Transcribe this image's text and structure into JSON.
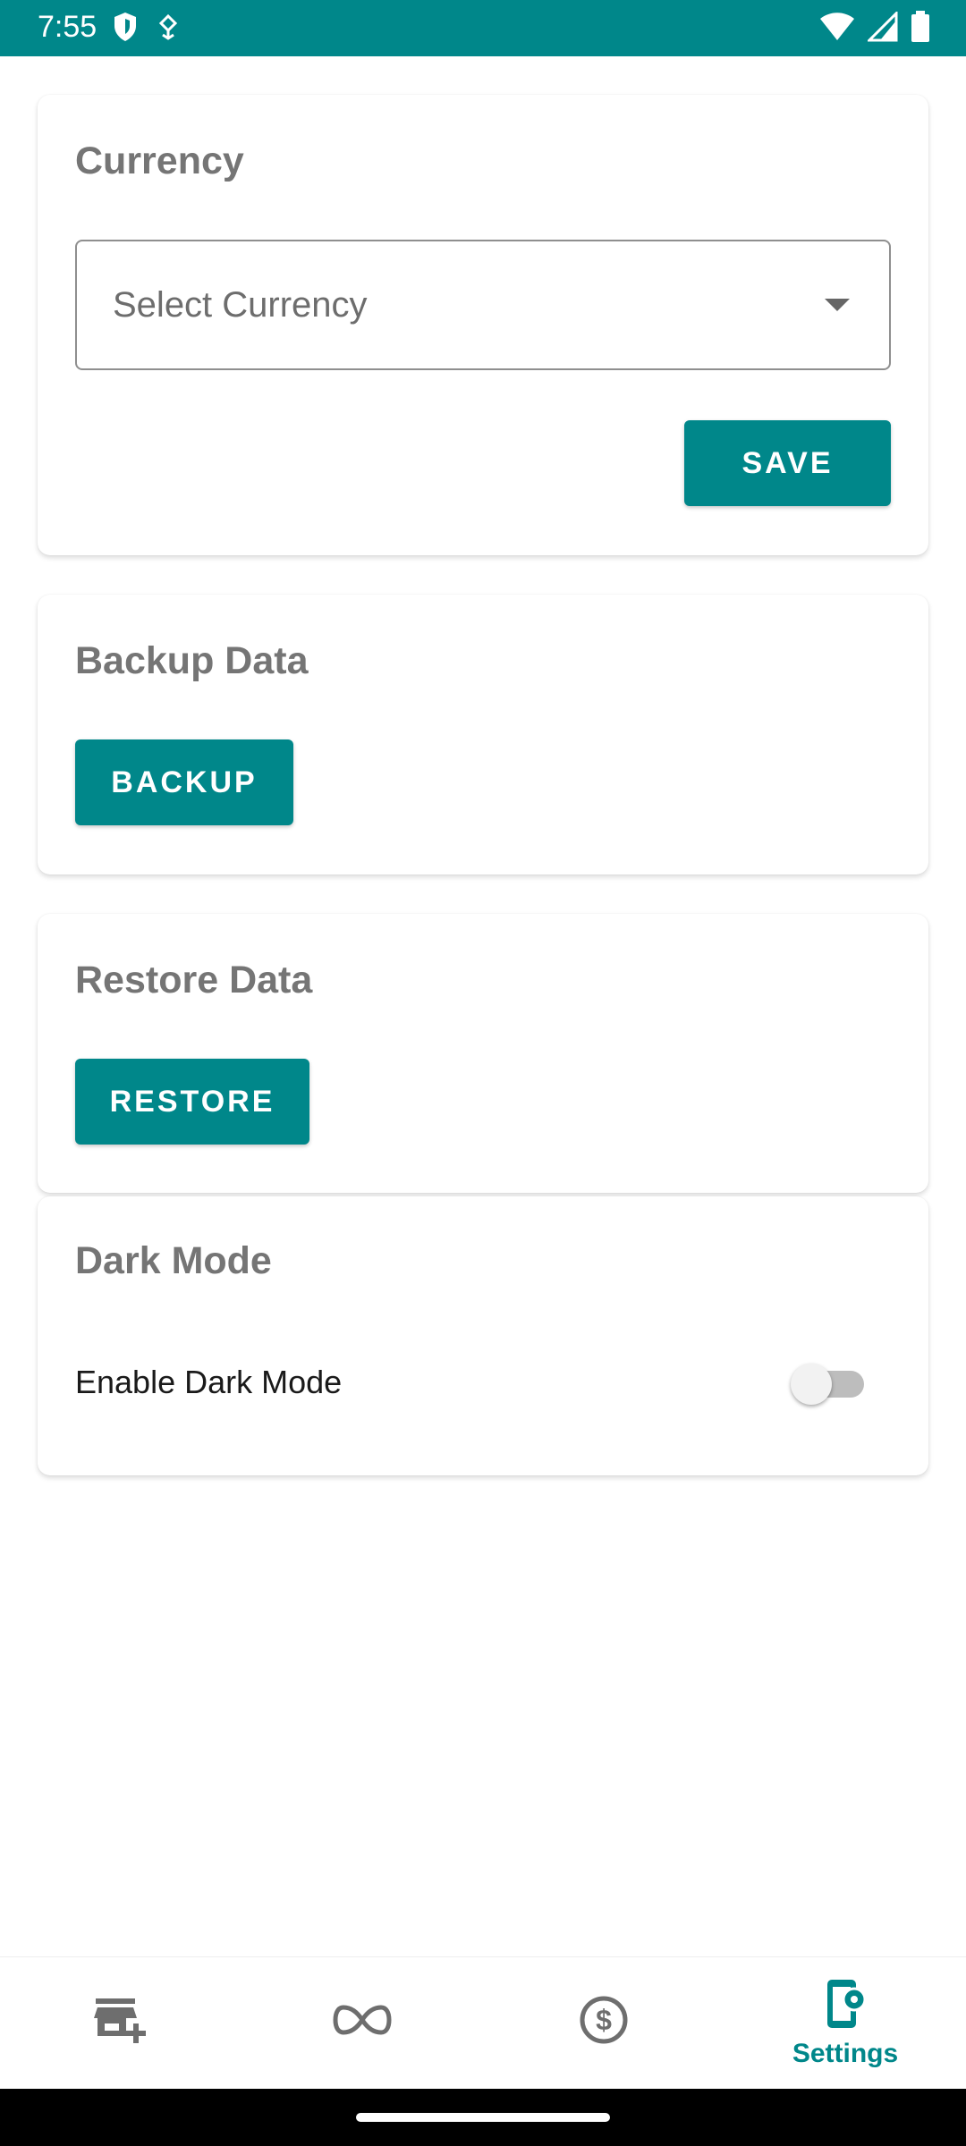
{
  "status_bar": {
    "time": "7:55",
    "background": "#00878a"
  },
  "currency_card": {
    "title": "Currency",
    "select_placeholder": "Select Currency",
    "save_label": "SAVE"
  },
  "backup_card": {
    "title": "Backup Data",
    "button_label": "BACKUP"
  },
  "restore_card": {
    "title": "Restore Data",
    "button_label": "RESTORE"
  },
  "dark_mode_card": {
    "title": "Dark Mode",
    "toggle_label": "Enable Dark Mode",
    "enabled": false
  },
  "bottom_nav": {
    "items": [
      {
        "icon": "add-store-icon",
        "label": "",
        "active": false
      },
      {
        "icon": "infinity-icon",
        "label": "",
        "active": false
      },
      {
        "icon": "dollar-circle-icon",
        "label": "",
        "active": false
      },
      {
        "icon": "settings-phone-icon",
        "label": "Settings",
        "active": true
      }
    ]
  },
  "colors": {
    "accent": "#00878a",
    "title_gray": "#757575",
    "icon_gray": "#6e6e6e"
  }
}
